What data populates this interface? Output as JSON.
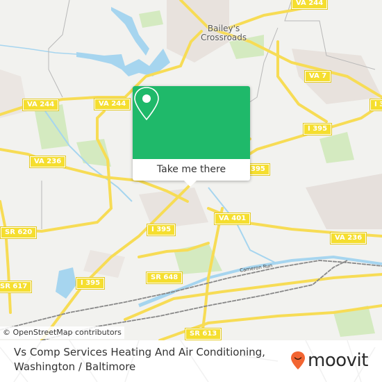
{
  "map": {
    "place_labels": [
      {
        "name": "baileys-crossroads",
        "line1": "Bailey's",
        "line2": "Crossroads"
      }
    ],
    "creek_label": "Cameron Run",
    "shields": [
      {
        "id": "va244-top",
        "label": "VA 244"
      },
      {
        "id": "va244-left",
        "label": "VA 244"
      },
      {
        "id": "va244-mid",
        "label": "VA 244"
      },
      {
        "id": "va7",
        "label": "VA 7"
      },
      {
        "id": "i395-right",
        "label": "I 395"
      },
      {
        "id": "i395-ne",
        "label": "I 3"
      },
      {
        "id": "i395-center",
        "label": "I 395"
      },
      {
        "id": "i395-popup",
        "label": "395"
      },
      {
        "id": "va236-left",
        "label": "VA 236"
      },
      {
        "id": "va401",
        "label": "VA 401"
      },
      {
        "id": "va236-right",
        "label": "VA 236"
      },
      {
        "id": "sr620",
        "label": "SR 620"
      },
      {
        "id": "sr617",
        "label": "SR 617"
      },
      {
        "id": "i395-lower",
        "label": "I 395"
      },
      {
        "id": "sr648",
        "label": "SR 648"
      },
      {
        "id": "sr613",
        "label": "SR 613"
      }
    ],
    "attribution": "© OpenStreetMap contributors"
  },
  "popup": {
    "icon": "location-pin-icon",
    "button_label": "Take me there"
  },
  "footer": {
    "title_line1": "Vs Comp Services Heating And Air Conditioning,",
    "title_line2": "Washington / Baltimore",
    "logo_text": "moovit",
    "logo_color": "#f26532",
    "accent_color": "#1fb96a"
  }
}
